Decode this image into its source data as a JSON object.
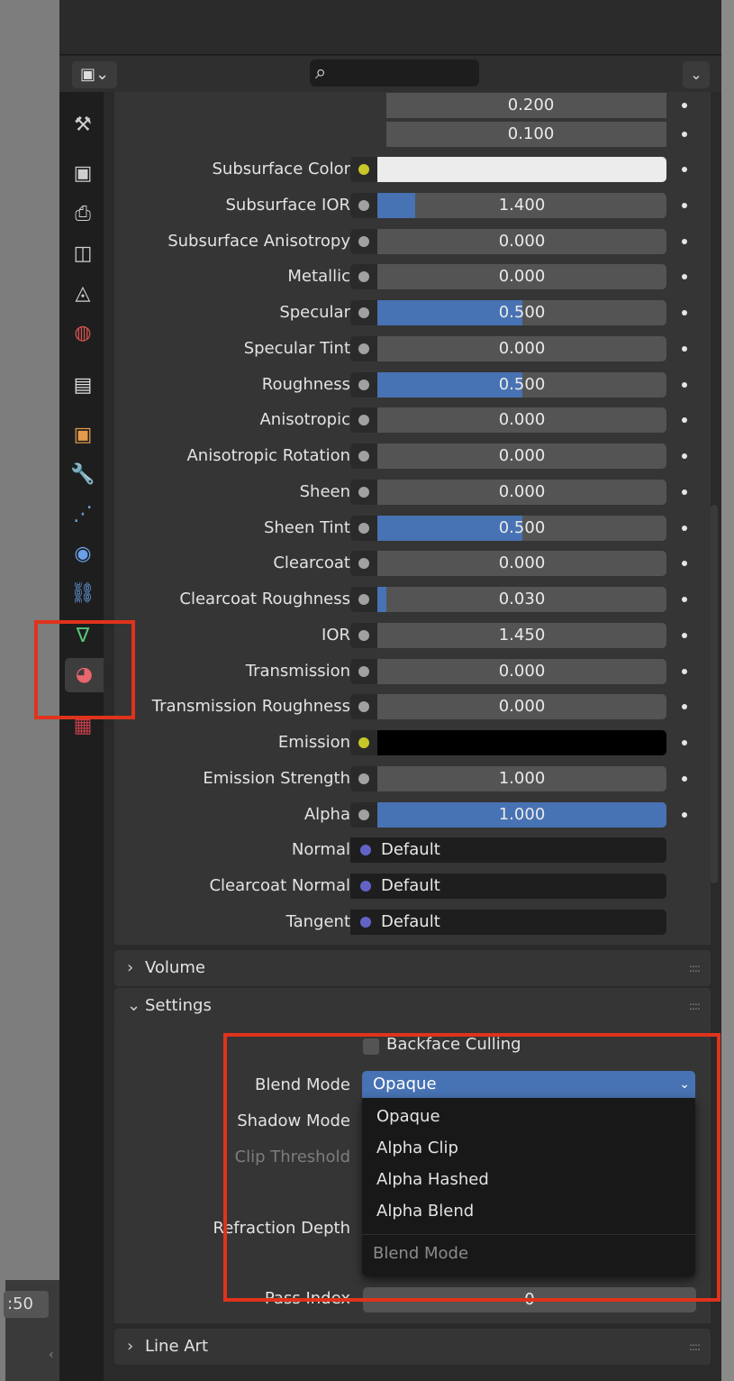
{
  "viewport": {
    "field_value": ":50",
    "chevron": "‹"
  },
  "header": {
    "editor_type": "▣⌄",
    "search_placeholder": "",
    "search_icon": "⌕",
    "options_chevron": "⌄"
  },
  "tabs": [
    {
      "name": "tool-tab",
      "icon": "⚒",
      "color": "#cfcfcf"
    },
    {
      "name": "render-tab",
      "icon": "▣",
      "color": "#cfcfcf"
    },
    {
      "name": "output-tab",
      "icon": "⎙",
      "color": "#cfcfcf"
    },
    {
      "name": "view-layer-tab",
      "icon": "◫",
      "color": "#cfcfcf"
    },
    {
      "name": "scene-tab",
      "icon": "◬",
      "color": "#cfcfcf"
    },
    {
      "name": "world-tab",
      "icon": "◍",
      "color": "#d9534f"
    },
    {
      "name": "collection-tab",
      "icon": "▤",
      "color": "#e0e0e0"
    },
    {
      "name": "object-tab",
      "icon": "▣",
      "color": "#e39a4a"
    },
    {
      "name": "modifiers-tab",
      "icon": "🔧",
      "color": "#6aa0e8"
    },
    {
      "name": "particles-tab",
      "icon": "⋰",
      "color": "#6aa0e8"
    },
    {
      "name": "physics-tab",
      "icon": "◉",
      "color": "#6aa0e8"
    },
    {
      "name": "constraints-tab",
      "icon": "⛓",
      "color": "#6aa0e8"
    },
    {
      "name": "data-tab",
      "icon": "∇",
      "color": "#59c47b"
    },
    {
      "name": "material-tab",
      "icon": "◕",
      "color": "#e8666d",
      "active": true
    },
    {
      "name": "texture-tab",
      "icon": "▦",
      "color": "#c0404a"
    }
  ],
  "vector_rows": [
    "0.200",
    "0.100"
  ],
  "properties": [
    {
      "label": "Subsurface Color",
      "socket": "yellow",
      "type": "color",
      "color": "#ececec"
    },
    {
      "label": "Subsurface IOR",
      "socket": "grey",
      "value": "1.400",
      "fill": 0.13
    },
    {
      "label": "Subsurface Anisotropy",
      "socket": "grey",
      "value": "0.000",
      "fill": 0
    },
    {
      "label": "Metallic",
      "socket": "grey",
      "value": "0.000",
      "fill": 0
    },
    {
      "label": "Specular",
      "socket": "grey",
      "value": "0.500",
      "fill": 0.5
    },
    {
      "label": "Specular Tint",
      "socket": "grey",
      "value": "0.000",
      "fill": 0
    },
    {
      "label": "Roughness",
      "socket": "grey",
      "value": "0.500",
      "fill": 0.5
    },
    {
      "label": "Anisotropic",
      "socket": "grey",
      "value": "0.000",
      "fill": 0
    },
    {
      "label": "Anisotropic Rotation",
      "socket": "grey",
      "value": "0.000",
      "fill": 0
    },
    {
      "label": "Sheen",
      "socket": "grey",
      "value": "0.000",
      "fill": 0
    },
    {
      "label": "Sheen Tint",
      "socket": "grey",
      "value": "0.500",
      "fill": 0.5
    },
    {
      "label": "Clearcoat",
      "socket": "grey",
      "value": "0.000",
      "fill": 0
    },
    {
      "label": "Clearcoat Roughness",
      "socket": "grey",
      "value": "0.030",
      "fill": 0.03
    },
    {
      "label": "IOR",
      "socket": "grey",
      "value": "1.450",
      "fill": 0
    },
    {
      "label": "Transmission",
      "socket": "grey",
      "value": "0.000",
      "fill": 0
    },
    {
      "label": "Transmission Roughness",
      "socket": "grey",
      "value": "0.000",
      "fill": 0
    },
    {
      "label": "Emission",
      "socket": "yellow",
      "type": "color",
      "color": "#000000"
    },
    {
      "label": "Emission Strength",
      "socket": "grey",
      "value": "1.000",
      "fill": 0
    },
    {
      "label": "Alpha",
      "socket": "grey",
      "value": "1.000",
      "fill": 1.0
    },
    {
      "label": "Normal",
      "socket": "violet",
      "type": "vector",
      "value": "Default"
    },
    {
      "label": "Clearcoat Normal",
      "socket": "violet",
      "type": "vector",
      "value": "Default"
    },
    {
      "label": "Tangent",
      "socket": "violet",
      "type": "vector",
      "value": "Default"
    }
  ],
  "panels": {
    "volume": {
      "arrow": "›",
      "title": "Volume",
      "grip": "::::"
    },
    "settings": {
      "arrow": "⌄",
      "title": "Settings",
      "grip": "::::"
    },
    "line_art": {
      "arrow": "›",
      "title": "Line Art",
      "grip": "::::"
    }
  },
  "settings": {
    "backface_culling": "Backface Culling",
    "blend_mode_label": "Blend Mode",
    "shadow_mode_label": "Shadow Mode",
    "clip_threshold_label": "Clip Threshold",
    "refraction_depth_label": "Refraction Depth",
    "pass_index_label": "Pass Index",
    "pass_index_value": "0"
  },
  "blend_dropdown": {
    "selected": "Opaque",
    "chevron": "⌄",
    "options": [
      "Opaque",
      "Alpha Clip",
      "Alpha Hashed",
      "Alpha Blend"
    ],
    "menu_title": "Blend Mode"
  },
  "colors": {
    "accent": "#4772b3",
    "highlight": "#e0331c",
    "socket_grey": "#a1a1a1",
    "socket_yellow": "#c7c729",
    "socket_violet": "#6363c7"
  }
}
